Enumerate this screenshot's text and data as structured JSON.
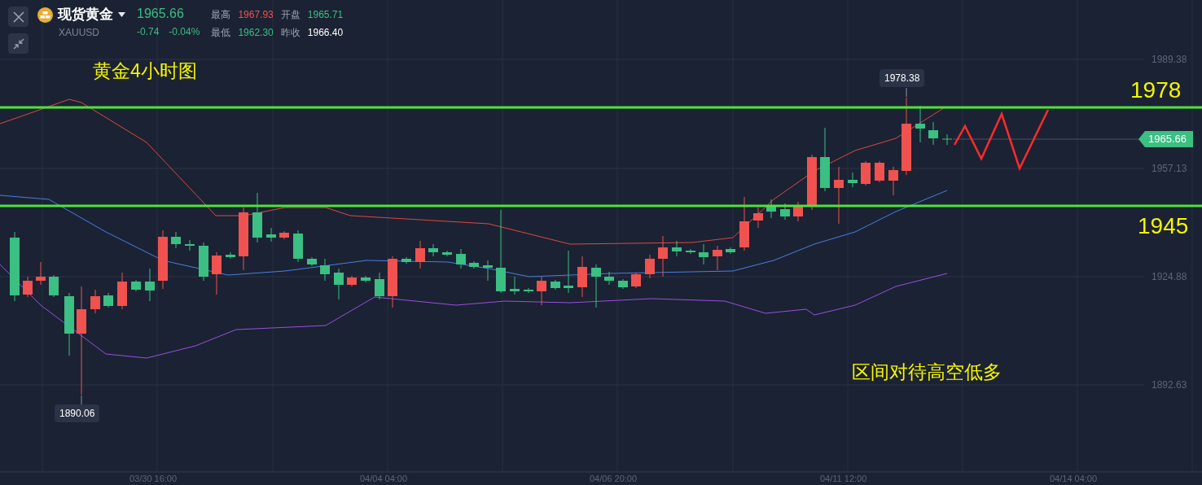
{
  "header": {
    "name": "现货黄金",
    "symbol": "XAUUSD",
    "price": "1965.66",
    "change": "-0.74",
    "change_pct": "-0.04%",
    "falling": true,
    "stats": [
      {
        "label": "最高",
        "value": "1967.93",
        "color": "#f0524f"
      },
      {
        "label": "开盘",
        "value": "1965.71",
        "color": "#3bbf83"
      },
      {
        "label": "最低",
        "value": "1962.30",
        "color": "#3bbf83"
      },
      {
        "label": "昨收",
        "value": "1966.40",
        "color": "#ffffff"
      }
    ]
  },
  "chart": {
    "title_note": "黄金4小时图",
    "strategy_note": "区间对待高空低多",
    "levels": [
      {
        "label": "1978"
      },
      {
        "label": "1945"
      }
    ],
    "y_axis_labels": [
      "1989.38",
      "1957.13",
      "1924.88",
      "1892.63"
    ],
    "x_axis_labels": [
      "03/30 16:00",
      "04/04 04:00",
      "04/06 20:00",
      "04/11 12:00",
      "04/14 04:00"
    ],
    "current_price_tag": "1965.66",
    "high_marker": "1978.38",
    "low_marker": "1890.06"
  }
}
